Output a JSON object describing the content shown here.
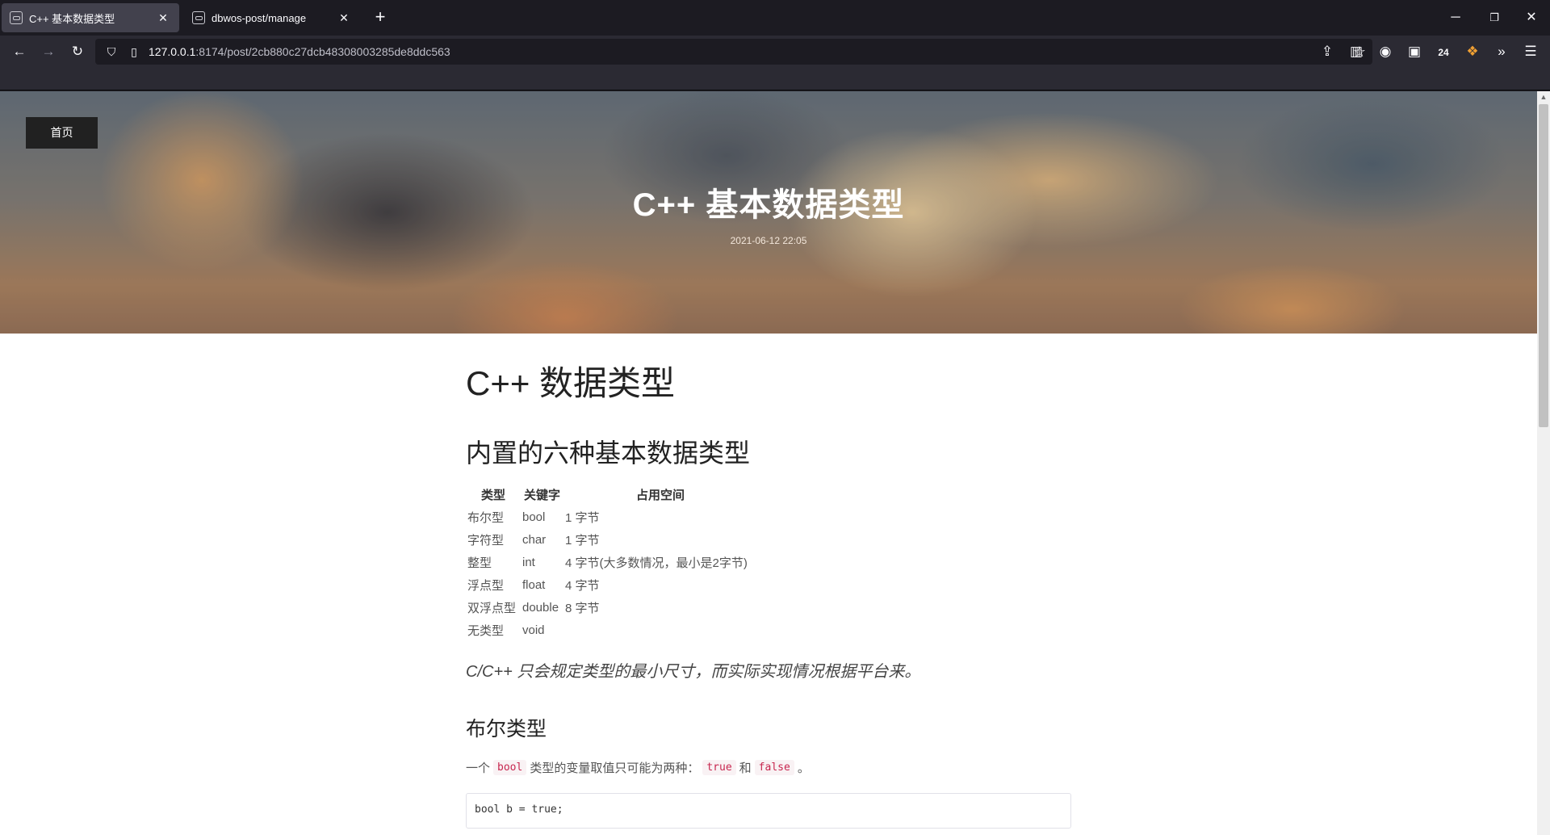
{
  "browser": {
    "tabs": [
      {
        "title": "C++ 基本数据类型",
        "active": true
      },
      {
        "title": "dbwos-post/manage",
        "active": false
      }
    ],
    "new_tab_icon": "+",
    "window": {
      "minimize": "─",
      "restore": "❐",
      "close": "✕"
    },
    "url": {
      "host": "127.0.0.1",
      "path": ":8174/post/2cb880c27dcb48308003285de8ddc563"
    },
    "toolbar_badge_count": "24",
    "icons": [
      "back-icon",
      "forward-icon",
      "reload-icon",
      "shield-icon",
      "page-icon",
      "bookmark-star-icon",
      "extensions-icon",
      "sidebar-icon",
      "account-icon",
      "reader-icon",
      "addon-icon",
      "overflow-icon",
      "menu-icon"
    ]
  },
  "page": {
    "home_button": "首页",
    "hero": {
      "title": "C++ 基本数据类型",
      "date": "2021-06-12 22:05"
    },
    "h1": "C++ 数据类型",
    "h2": "内置的六种基本数据类型",
    "table": {
      "headers": [
        "类型",
        "关键字",
        "占用空间"
      ],
      "rows": [
        [
          "布尔型",
          "bool",
          "1 字节"
        ],
        [
          "字符型",
          "char",
          "1 字节"
        ],
        [
          "整型",
          "int",
          "4 字节(大多数情况，最小是2字节)"
        ],
        [
          "浮点型",
          "float",
          "4 字节"
        ],
        [
          "双浮点型",
          "double",
          "8 字节"
        ],
        [
          "无类型",
          "void",
          ""
        ]
      ]
    },
    "quote": "C/C++ 只会规定类型的最小尺寸，而实际实现情况根据平台来。",
    "h3": "布尔类型",
    "paragraph": {
      "prefix": "一个",
      "code1": "bool",
      "mid": "类型的变量取值只可能为两种：",
      "code2": "true",
      "and": "和",
      "code3": "false",
      "suffix": "。"
    },
    "code_block": "bool b = true;"
  }
}
